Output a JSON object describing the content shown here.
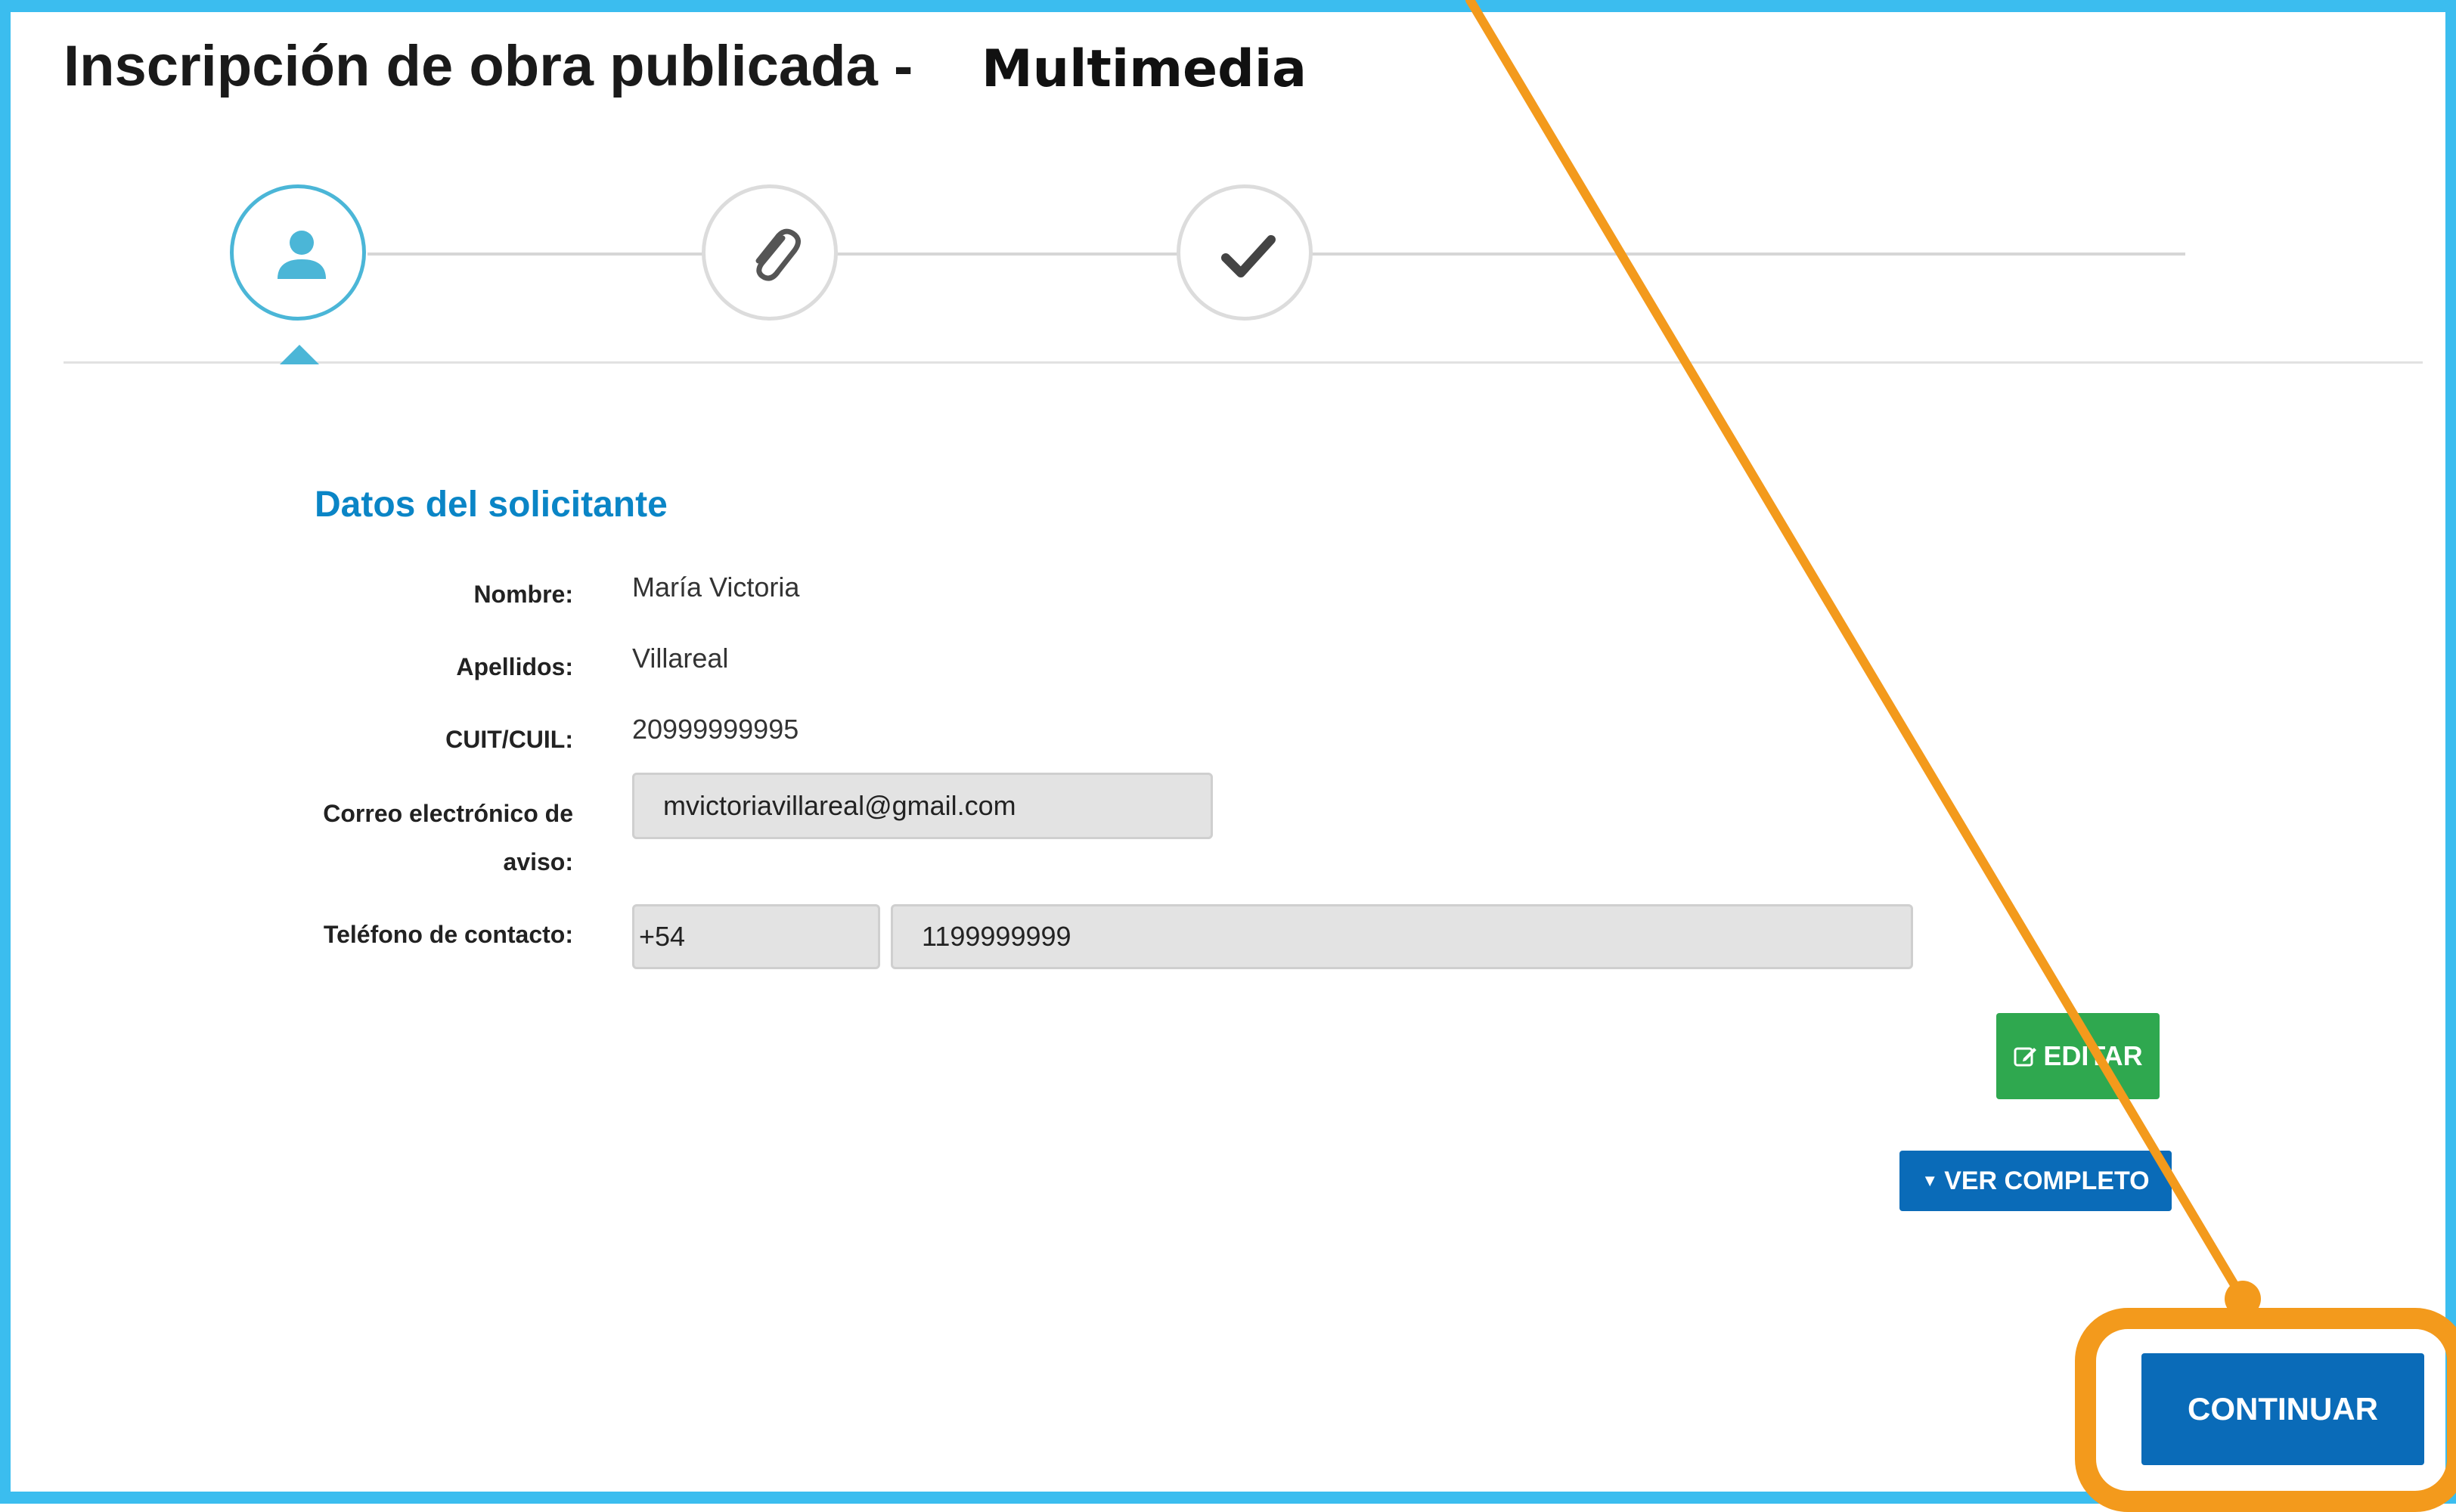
{
  "header": {
    "title": "Inscripción de obra publicada -",
    "subtitle": "Multimedia"
  },
  "stepper": {
    "steps": [
      {
        "icon": "user-icon",
        "active": true
      },
      {
        "icon": "paperclip-icon",
        "active": false
      },
      {
        "icon": "checkmark-icon",
        "active": false
      }
    ]
  },
  "section": {
    "title": "Datos del solicitante"
  },
  "fields": {
    "nombre": {
      "label": "Nombre:",
      "value": "María Victoria"
    },
    "apellidos": {
      "label": "Apellidos:",
      "value": "Villareal"
    },
    "cuit": {
      "label": "CUIT/CUIL:",
      "value": "20999999995"
    },
    "correo": {
      "label_line1": "Correo electrónico de",
      "label_line2": "aviso:",
      "value": "mvictoriavillareal@gmail.com"
    },
    "telefono": {
      "label": "Teléfono de contacto:",
      "prefix": "+54",
      "number": "1199999999"
    }
  },
  "buttons": {
    "edit_label": "EDITAR",
    "ver_label": "VER COMPLETO",
    "continuar_label": "CONTINUAR"
  },
  "colors": {
    "frame": "#3bbdef",
    "accent": "#0a85c6",
    "primary_button": "#0a6bb8",
    "edit_button": "#2fa84f",
    "highlight": "#f39a1c"
  }
}
